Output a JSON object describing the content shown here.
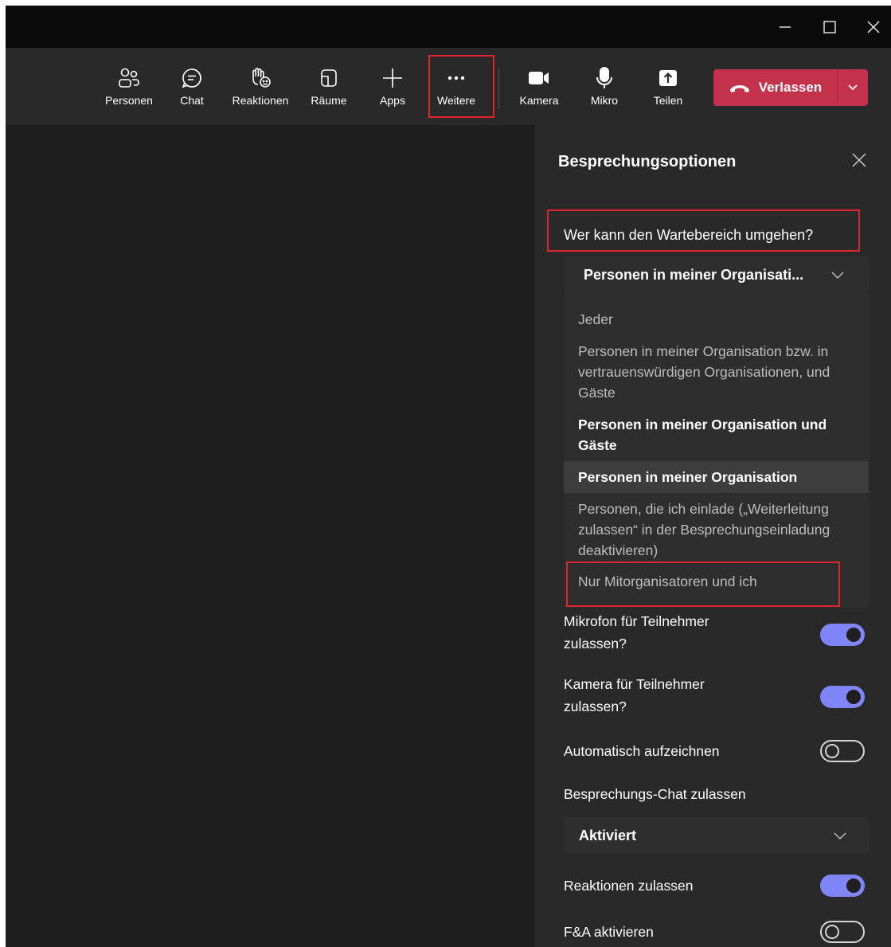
{
  "window_controls": {
    "minimize": "minimize-icon",
    "maximize": "maximize-icon",
    "close": "close-icon"
  },
  "toolbar": {
    "buttons": [
      {
        "label": "Personen",
        "icon": "people-icon"
      },
      {
        "label": "Chat",
        "icon": "chat-icon"
      },
      {
        "label": "Reaktionen",
        "icon": "raise-hand-icon"
      },
      {
        "label": "Räume",
        "icon": "rooms-icon"
      },
      {
        "label": "Apps",
        "icon": "plus-icon"
      },
      {
        "label": "Weitere",
        "icon": "more-icon"
      },
      {
        "label": "Kamera",
        "icon": "camera-icon"
      },
      {
        "label": "Mikro",
        "icon": "microphone-icon"
      },
      {
        "label": "Teilen",
        "icon": "share-icon"
      }
    ],
    "leave_label": "Verlassen"
  },
  "panel": {
    "title": "Besprechungsoptionen",
    "lobby_question": "Wer kann den Wartebereich umgehen?",
    "lobby_selected": "Personen in meiner Organisati...",
    "lobby_options": [
      {
        "text": "Jeder"
      },
      {
        "text": "Personen in meiner Organisation bzw. in vertrauenswürdigen Organisationen, und Gäste"
      },
      {
        "text": "Personen in meiner Organisation und Gäste"
      },
      {
        "text": "Personen in meiner Organisation"
      },
      {
        "text": "Personen, die ich einlade („Weiterleitung zulassen“ in der Besprechungseinladung deaktivieren)"
      },
      {
        "text": "Nur Mitorganisatoren und ich"
      }
    ],
    "settings": [
      {
        "label": "Mikrofon für Teilnehmer zulassen?",
        "on": true
      },
      {
        "label": "Kamera für Teilnehmer zulassen?",
        "on": true
      },
      {
        "label": "Automatisch aufzeichnen",
        "on": false
      },
      {
        "label": "Besprechungs-Chat zulassen"
      },
      {
        "label": "Reaktionen zulassen",
        "on": true
      },
      {
        "label": "F&A aktivieren",
        "on": false
      }
    ],
    "chat_selected": "Aktiviert"
  },
  "colors": {
    "accent": "#7f85f5",
    "leave": "#c4314b",
    "highlight": "#e0242b",
    "panel": "#292929"
  }
}
